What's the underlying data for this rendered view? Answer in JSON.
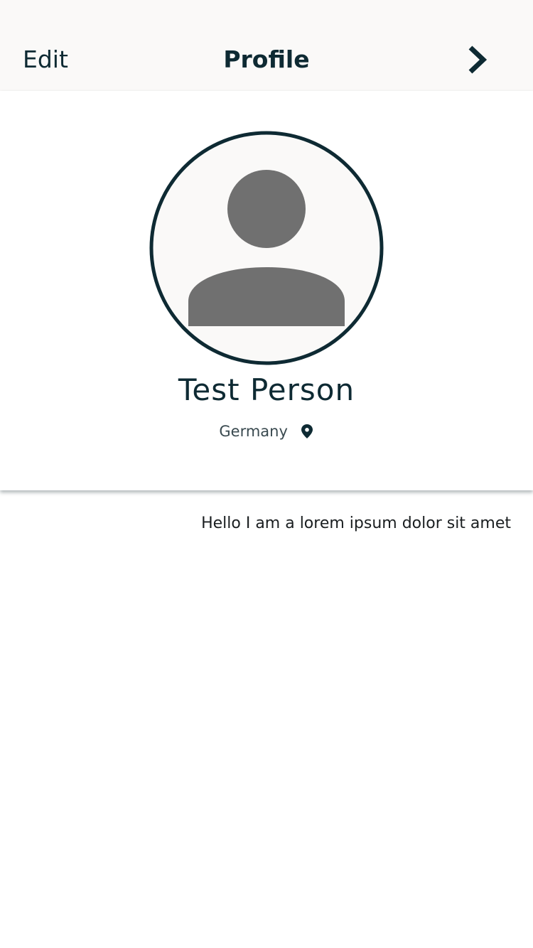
{
  "nav": {
    "edit_label": "Edit",
    "title": "Profile",
    "next_icon": "chevron-right-icon"
  },
  "profile": {
    "avatar_icon": "person-placeholder-icon",
    "name": "Test Person",
    "location": "Germany",
    "location_icon": "location-pin-icon",
    "bio": "Hello I am a lorem ipsum dolor sit amet"
  },
  "colors": {
    "primary_text": "#0e2a33",
    "nav_background": "#faf9f8",
    "avatar_border": "#0e2a33",
    "avatar_fill": "#faf9f8",
    "avatar_silhouette": "#707070"
  }
}
